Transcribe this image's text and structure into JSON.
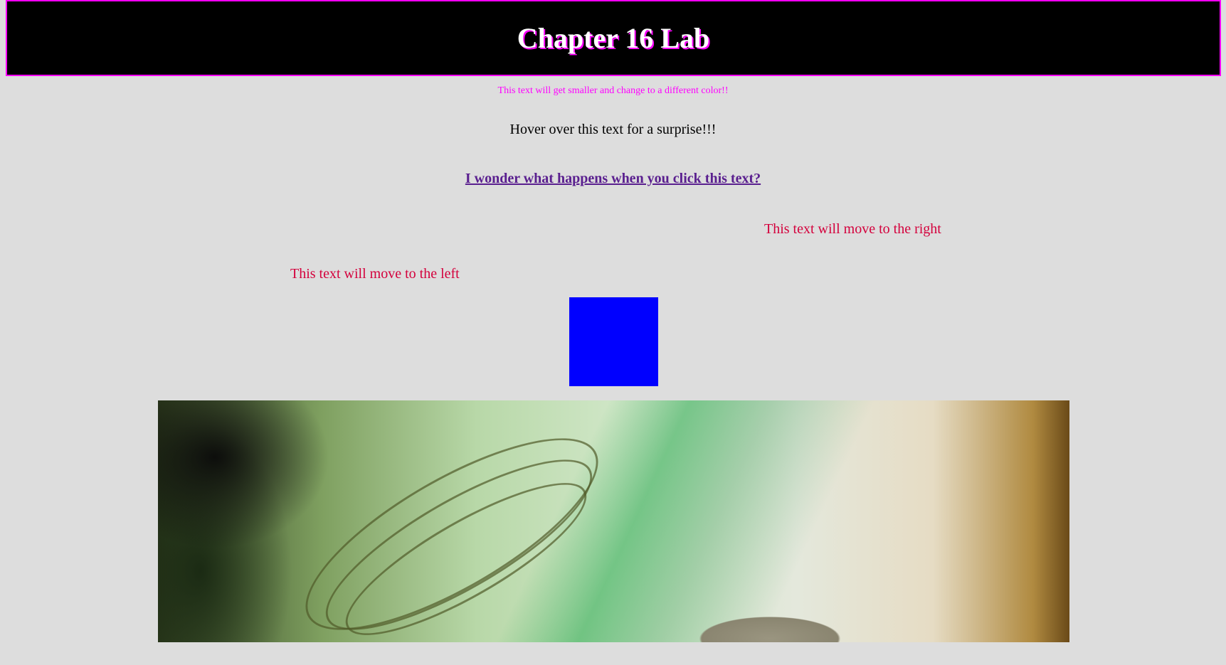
{
  "header": {
    "title": "Chapter 16 Lab"
  },
  "texts": {
    "shrink": "This text will get smaller and change to a different color!!",
    "hover": "Hover over this text for a surprise!!!",
    "link": "I wonder what happens when you click this text?",
    "move_right": "This text will move to the right",
    "move_left": "This text will move to the left"
  },
  "colors": {
    "accent": "#ff00ff",
    "box": "#0000ff",
    "moving_text": "#d4003c",
    "link": "#5a1f8f"
  }
}
